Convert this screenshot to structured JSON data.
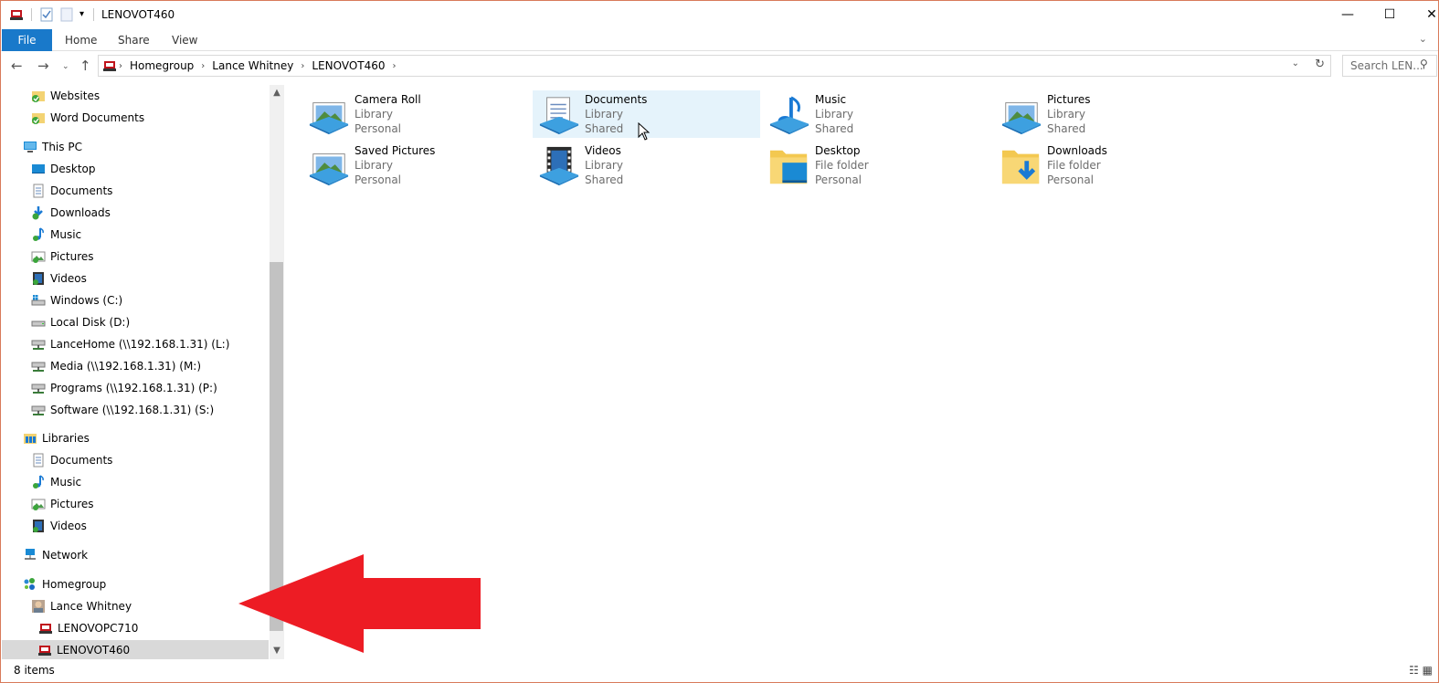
{
  "window": {
    "title": "LENOVOT460",
    "minimize_glyph": "—",
    "maximize_glyph": "☐",
    "close_glyph": "✕"
  },
  "ribbon": {
    "tabs": [
      "File",
      "Home",
      "Share",
      "View"
    ]
  },
  "address": {
    "crumbs": [
      "Homegroup",
      "Lance Whitney",
      "LENOVOT460"
    ],
    "search_placeholder": "Search LEN..."
  },
  "sidebar": {
    "items": [
      {
        "label": "Websites",
        "icon": "library-folder-icon"
      },
      {
        "label": "Word Documents",
        "icon": "library-folder-icon"
      },
      {
        "label": "This PC",
        "icon": "computer-icon"
      },
      {
        "label": "Desktop",
        "icon": "desktop-icon"
      },
      {
        "label": "Documents",
        "icon": "documents-icon"
      },
      {
        "label": "Downloads",
        "icon": "downloads-icon"
      },
      {
        "label": "Music",
        "icon": "music-icon"
      },
      {
        "label": "Pictures",
        "icon": "pictures-icon"
      },
      {
        "label": "Videos",
        "icon": "videos-icon"
      },
      {
        "label": "Windows (C:)",
        "icon": "windows-drive-icon"
      },
      {
        "label": "Local Disk (D:)",
        "icon": "drive-icon"
      },
      {
        "label": "LanceHome (\\\\192.168.1.31) (L:)",
        "icon": "network-drive-icon"
      },
      {
        "label": "Media (\\\\192.168.1.31) (M:)",
        "icon": "network-drive-icon"
      },
      {
        "label": "Programs (\\\\192.168.1.31) (P:)",
        "icon": "network-drive-icon"
      },
      {
        "label": "Software (\\\\192.168.1.31) (S:)",
        "icon": "network-drive-icon"
      },
      {
        "label": "Libraries",
        "icon": "libraries-icon"
      },
      {
        "label": "Documents",
        "icon": "documents-icon"
      },
      {
        "label": "Music",
        "icon": "music-icon"
      },
      {
        "label": "Pictures",
        "icon": "pictures-icon"
      },
      {
        "label": "Videos",
        "icon": "videos-icon"
      },
      {
        "label": "Network",
        "icon": "network-icon"
      },
      {
        "label": "Homegroup",
        "icon": "homegroup-icon"
      },
      {
        "label": "Lance Whitney",
        "icon": "user-avatar-icon"
      },
      {
        "label": "LENOVOPC710",
        "icon": "pc-icon"
      },
      {
        "label": "LENOVOT460",
        "icon": "pc-icon",
        "selected": true
      }
    ]
  },
  "tiles": [
    {
      "name": "Camera Roll",
      "type": "Library",
      "owner": "Personal",
      "icon": "pictures-library-icon"
    },
    {
      "name": "Documents",
      "type": "Library",
      "owner": "Shared",
      "icon": "documents-library-icon"
    },
    {
      "name": "Music",
      "type": "Library",
      "owner": "Shared",
      "icon": "music-library-icon"
    },
    {
      "name": "Pictures",
      "type": "Library",
      "owner": "Shared",
      "icon": "pictures-library-icon"
    },
    {
      "name": "Saved Pictures",
      "type": "Library",
      "owner": "Personal",
      "icon": "pictures-library-icon"
    },
    {
      "name": "Videos",
      "type": "Library",
      "owner": "Shared",
      "icon": "videos-library-icon"
    },
    {
      "name": "Desktop",
      "type": "File folder",
      "owner": "Personal",
      "icon": "desktop-folder-icon"
    },
    {
      "name": "Downloads",
      "type": "File folder",
      "owner": "Personal",
      "icon": "downloads-folder-icon"
    }
  ],
  "status": {
    "item_count": "8 items"
  },
  "colors": {
    "file_tab": "#1979ca",
    "hover_tile": "#e5f3fb",
    "selected_nav": "#d9d9d9",
    "annotation_arrow": "#ed1c24"
  }
}
